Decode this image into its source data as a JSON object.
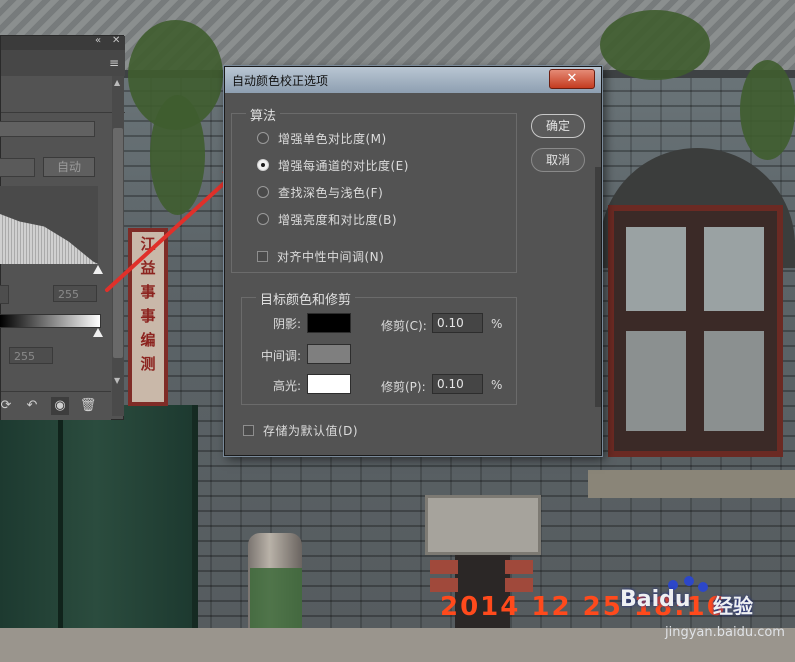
{
  "dialog": {
    "title": "自动颜色校正选项",
    "close_label": "✕",
    "algorithm_group": {
      "title": "算法",
      "options": [
        {
          "label": "增强单色对比度(M)",
          "selected": false
        },
        {
          "label": "增强每通道的对比度(E)",
          "selected": true
        },
        {
          "label": "查找深色与浅色(F)",
          "selected": false
        },
        {
          "label": "增强亮度和对比度(B)",
          "selected": false
        }
      ],
      "snap_neutral_label": "对齐中性中间调(N)",
      "snap_neutral_checked": false
    },
    "target_group": {
      "title": "目标颜色和修剪",
      "shadows_label": "阴影:",
      "shadows_color": "#000000",
      "shadows_clip_label": "修剪(C):",
      "shadows_clip_value": "0.10",
      "midtones_label": "中间调:",
      "midtones_color": "#7f7f7f",
      "highlights_label": "高光:",
      "highlights_color": "#ffffff",
      "highlights_clip_label": "修剪(P):",
      "highlights_clip_value": "0.10",
      "percent_sign": "%"
    },
    "save_default_label": "存储为默认值(D)",
    "save_default_checked": false,
    "ok_label": "确定",
    "cancel_label": "取消"
  },
  "levels_panel": {
    "auto_label": "自动",
    "input_white_value": "255",
    "output_white_value": "255",
    "icons": [
      "collapse-icon",
      "close-icon",
      "panel-menu-icon",
      "clip-to-layer-icon",
      "view-previous-icon",
      "reset-icon",
      "visibility-eye-icon",
      "delete-icon"
    ]
  },
  "photo": {
    "banner_text": [
      "江",
      "益",
      "事",
      "事",
      "编",
      "测"
    ],
    "date_stamp": "2014 12 25 18:16",
    "watermark_brand": "Baidu",
    "watermark_sub": "经验",
    "watermark_url": "jingyan.baidu.com"
  },
  "colors": {
    "annotation_arrow": "#e0302a",
    "dialog_titlebar": "#a4b3c2",
    "close_button": "#d2553a",
    "date_stamp": "#ff4a1c"
  }
}
